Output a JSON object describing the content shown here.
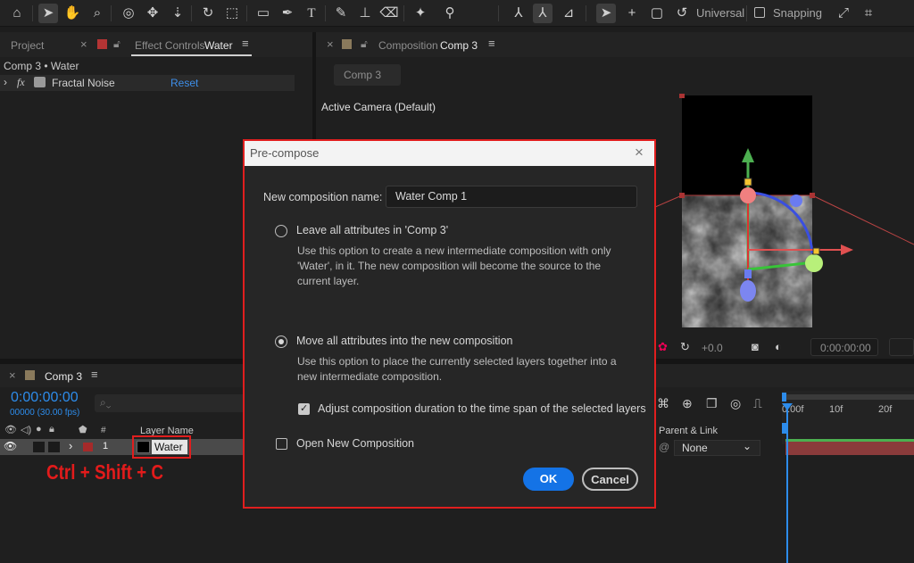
{
  "toolbar": {
    "universal_label": "Universal",
    "snapping_label": "Snapping"
  },
  "effect_panel": {
    "project_tab": "Project",
    "effect_tab_prefix": "Effect Controls",
    "effect_tab_layer": "Water",
    "breadcrumb": "Comp 3 • Water",
    "effect_name": "Fractal Noise",
    "fx_label": "fx",
    "reset_label": "Reset"
  },
  "comp_panel": {
    "tab_prefix": "Composition",
    "tab_name": "Comp 3",
    "sub_tab": "Comp 3",
    "camera_label": "Active Camera (Default)",
    "exposure_value": "+0.0",
    "timecode": "0:00:00:00"
  },
  "timeline": {
    "tab_name": "Comp 3",
    "timecode": "0:00:00:00",
    "frame_info": "00000 (30.00 fps)",
    "col_number": "#",
    "col_layer_name": "Layer Name",
    "col_parent": "Parent & Link",
    "layer_number": "1",
    "layer_name": "Water",
    "parent_value": "None",
    "ruler_labels": [
      "0:00f",
      "10f",
      "20f"
    ],
    "shortcut_annotation": "Ctrl + Shift + C"
  },
  "dialog": {
    "title": "Pre-compose",
    "name_label": "New composition name:",
    "name_value": "Water Comp 1",
    "option1_label": "Leave all attributes in 'Comp 3'",
    "option1_desc_1": "Use this option to create a new intermediate composition with only",
    "option1_desc_2": "'Water', in it. The new composition will become the source to the",
    "option1_desc_3": "current layer.",
    "option2_label": "Move all attributes into the new composition",
    "option2_desc_1": "Use this option to place the currently selected layers together into a",
    "option2_desc_2": "new intermediate composition.",
    "adjust_label": "Adjust composition duration to the time span of the selected layers",
    "open_new_label": "Open New Composition",
    "ok_label": "OK",
    "cancel_label": "Cancel",
    "option1_selected": false,
    "option2_selected": true,
    "adjust_checked": true,
    "open_new_checked": false
  },
  "colors": {
    "accent_blue": "#1473e6",
    "annotation_red": "#e01e1e",
    "timecode_blue": "#2d8ceb"
  }
}
